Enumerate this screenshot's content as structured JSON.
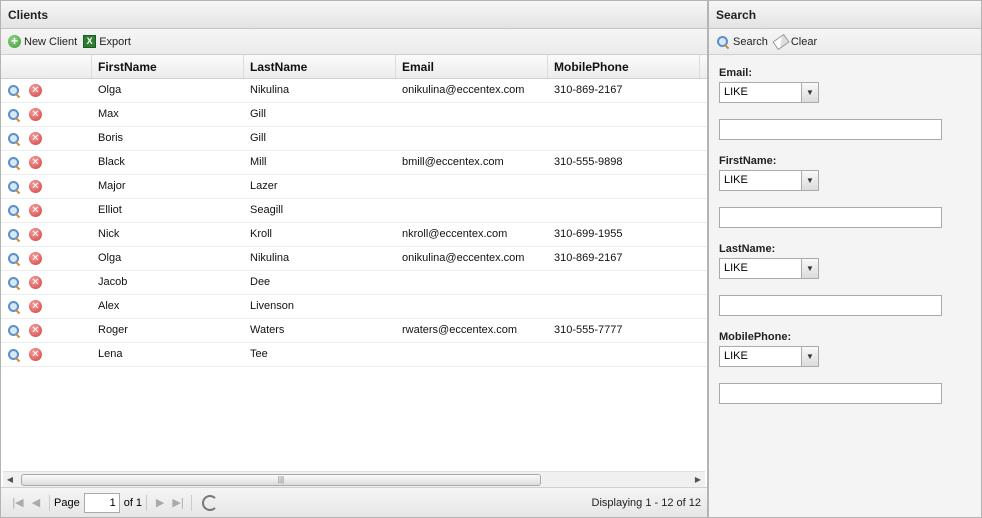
{
  "clients_panel": {
    "title": "Clients",
    "toolbar": {
      "new_client": "New Client",
      "export": "Export"
    },
    "columns": [
      "FirstName",
      "LastName",
      "Email",
      "MobilePhone"
    ],
    "rows": [
      {
        "first": "Olga",
        "last": "Nikulina",
        "email": "onikulina@eccentex.com",
        "mobile": "310-869-2167"
      },
      {
        "first": "Max",
        "last": "Gill",
        "email": "",
        "mobile": ""
      },
      {
        "first": "Boris",
        "last": "Gill",
        "email": "",
        "mobile": ""
      },
      {
        "first": "Black",
        "last": "Mill",
        "email": "bmill@eccentex.com",
        "mobile": "310-555-9898"
      },
      {
        "first": "Major",
        "last": "Lazer",
        "email": "",
        "mobile": ""
      },
      {
        "first": "Elliot",
        "last": "Seagill",
        "email": "",
        "mobile": ""
      },
      {
        "first": "Nick",
        "last": "Kroll",
        "email": "nkroll@eccentex.com",
        "mobile": "310-699-1955"
      },
      {
        "first": "Olga",
        "last": "Nikulina",
        "email": "onikulina@eccentex.com",
        "mobile": "310-869-2167"
      },
      {
        "first": "Jacob",
        "last": "Dee",
        "email": "",
        "mobile": ""
      },
      {
        "first": "Alex",
        "last": "Livenson",
        "email": "",
        "mobile": ""
      },
      {
        "first": "Roger",
        "last": "Waters",
        "email": "rwaters@eccentex.com",
        "mobile": "310-555-7777"
      },
      {
        "first": "Lena",
        "last": "Tee",
        "email": "",
        "mobile": ""
      }
    ],
    "pager": {
      "page_label": "Page",
      "page_value": "1",
      "of_label": "of 1",
      "display_text": "Displaying 1 - 12 of 12"
    }
  },
  "search_panel": {
    "title": "Search",
    "toolbar": {
      "search": "Search",
      "clear": "Clear"
    },
    "fields": [
      {
        "label": "Email:",
        "operator": "LIKE",
        "value": ""
      },
      {
        "label": "FirstName:",
        "operator": "LIKE",
        "value": ""
      },
      {
        "label": "LastName:",
        "operator": "LIKE",
        "value": ""
      },
      {
        "label": "MobilePhone:",
        "operator": "LIKE",
        "value": ""
      }
    ]
  },
  "icons": {
    "new_client": "add-circle-icon",
    "export": "excel-icon",
    "view": "magnifier-icon",
    "delete": "delete-circle-icon",
    "search": "magnifier-icon",
    "clear": "eraser-icon",
    "refresh": "refresh-icon"
  }
}
